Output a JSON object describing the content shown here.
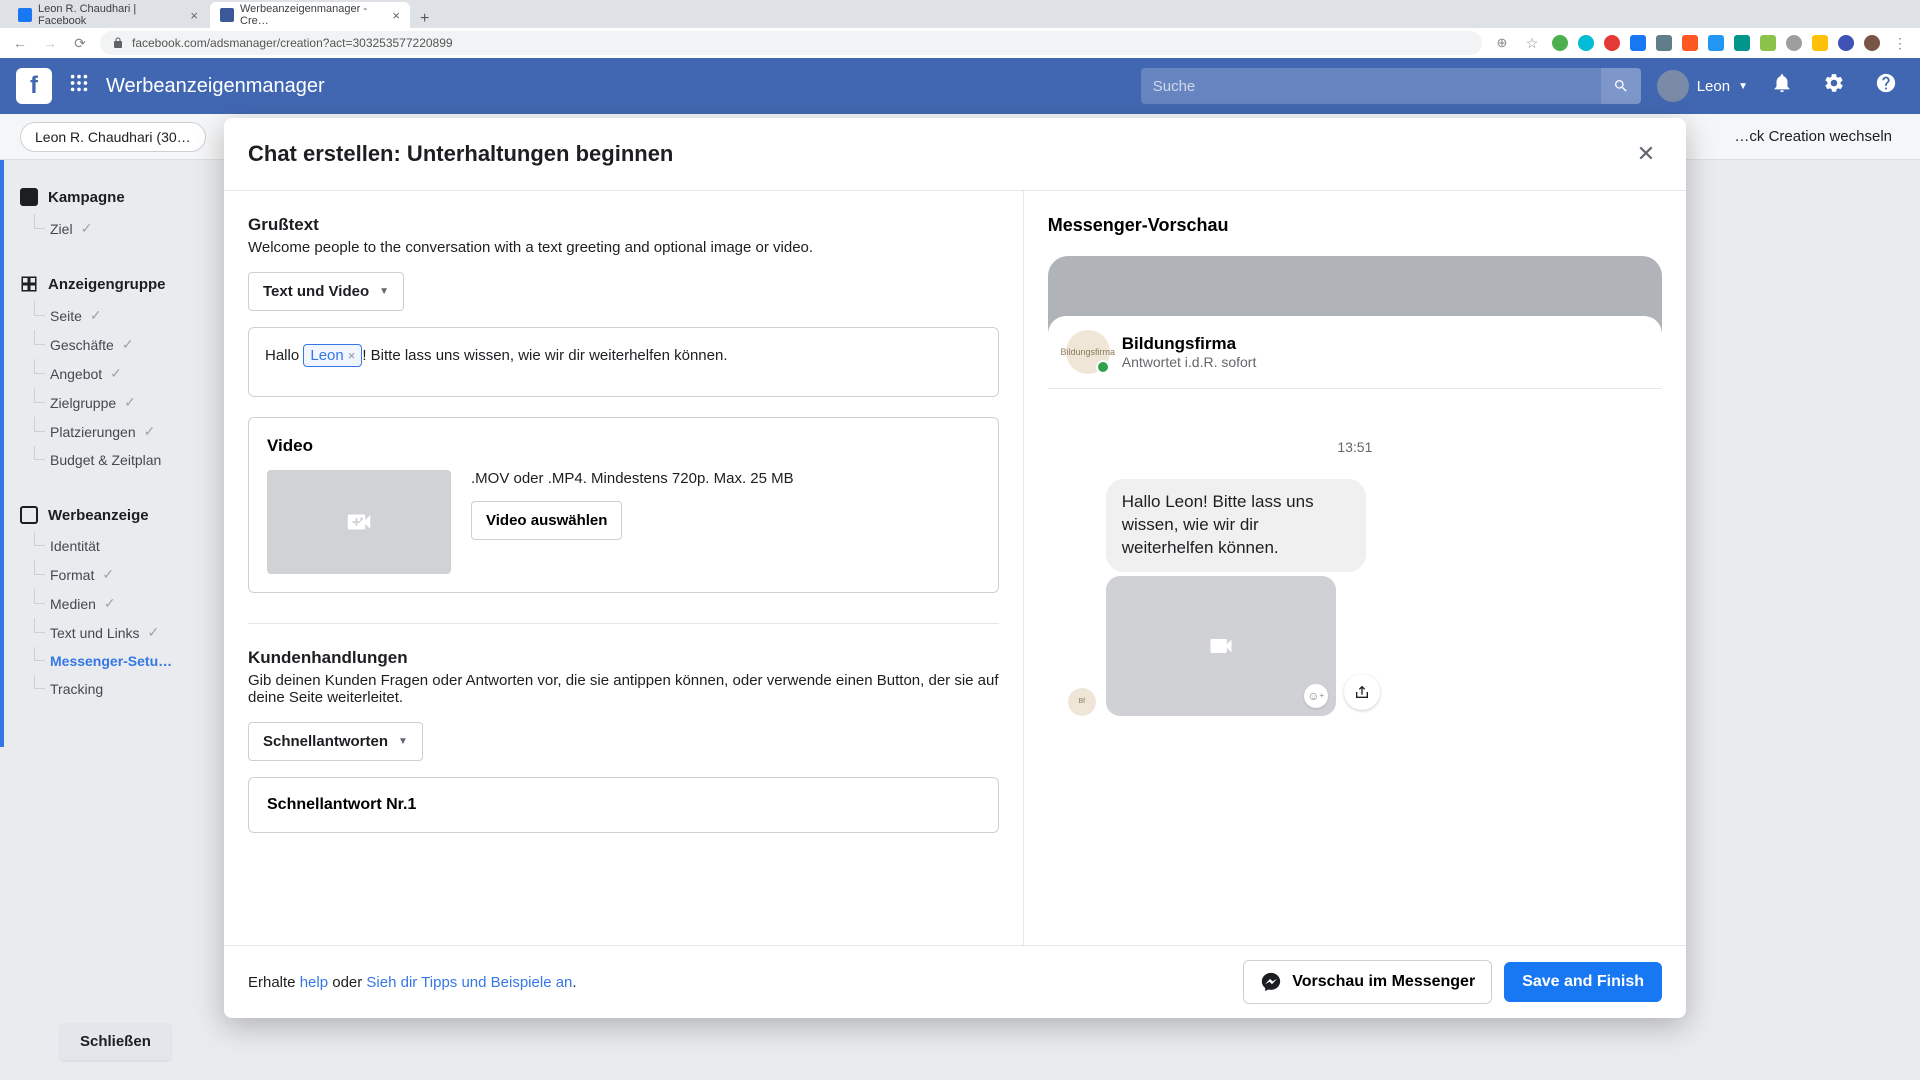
{
  "browser": {
    "tabs": [
      {
        "title": "Leon R. Chaudhari | Facebook",
        "active": false
      },
      {
        "title": "Werbeanzeigenmanager - Cre…",
        "active": true
      }
    ],
    "url": "facebook.com/adsmanager/creation?act=303253577220899"
  },
  "header": {
    "app_title": "Werbeanzeigenmanager",
    "search_placeholder": "Suche",
    "user_name": "Leon"
  },
  "breadcrumb": {
    "account": "Leon R. Chaudhari (30…",
    "switch_label": "…ck Creation wechseln"
  },
  "left_nav": {
    "campaign": {
      "head": "Kampagne",
      "items": [
        "Ziel"
      ]
    },
    "adset": {
      "head": "Anzeigengruppe",
      "items": [
        "Seite",
        "Geschäfte",
        "Angebot",
        "Zielgruppe",
        "Platzierungen",
        "Budget & Zeitplan"
      ]
    },
    "ad": {
      "head": "Werbeanzeige",
      "items": [
        "Identität",
        "Format",
        "Medien",
        "Text und Links",
        "Messenger-Setu…",
        "Tracking"
      ],
      "active_index": 4
    },
    "close_label": "Schließen"
  },
  "modal": {
    "title": "Chat erstellen: Unterhaltungen beginnen",
    "greeting": {
      "title": "Grußtext",
      "desc": "Welcome people to the conversation with a text greeting and optional image or video.",
      "dropdown": "Text und Video",
      "text_before": "Hallo ",
      "name_chip": "Leon",
      "text_after": "! Bitte lass uns wissen, wie wir dir weiterhelfen können."
    },
    "video": {
      "title": "Video",
      "spec": ".MOV oder .MP4. Mindestens 720p. Max. 25 MB",
      "button": "Video auswählen"
    },
    "actions": {
      "title": "Kundenhandlungen",
      "desc": "Gib deinen Kunden Fragen oder Antworten vor, die sie antippen können, oder verwende einen Button, der sie auf deine Seite weiterleitet.",
      "dropdown": "Schnellantworten",
      "qr1_title": "Schnellantwort Nr.1"
    },
    "footer": {
      "get": "Erhalte ",
      "help": "help",
      "or": " oder ",
      "tips": "Sieh dir Tipps und Beispiele an",
      "dot": ".",
      "preview_btn": "Vorschau im Messenger",
      "save_btn": "Save and Finish"
    }
  },
  "preview": {
    "title": "Messenger-Vorschau",
    "page_name": "Bildungsfirma",
    "response": "Antwortet i.d.R. sofort",
    "time": "13:51",
    "message": "Hallo Leon! Bitte lass uns wissen, wie wir dir weiterhelfen können."
  }
}
